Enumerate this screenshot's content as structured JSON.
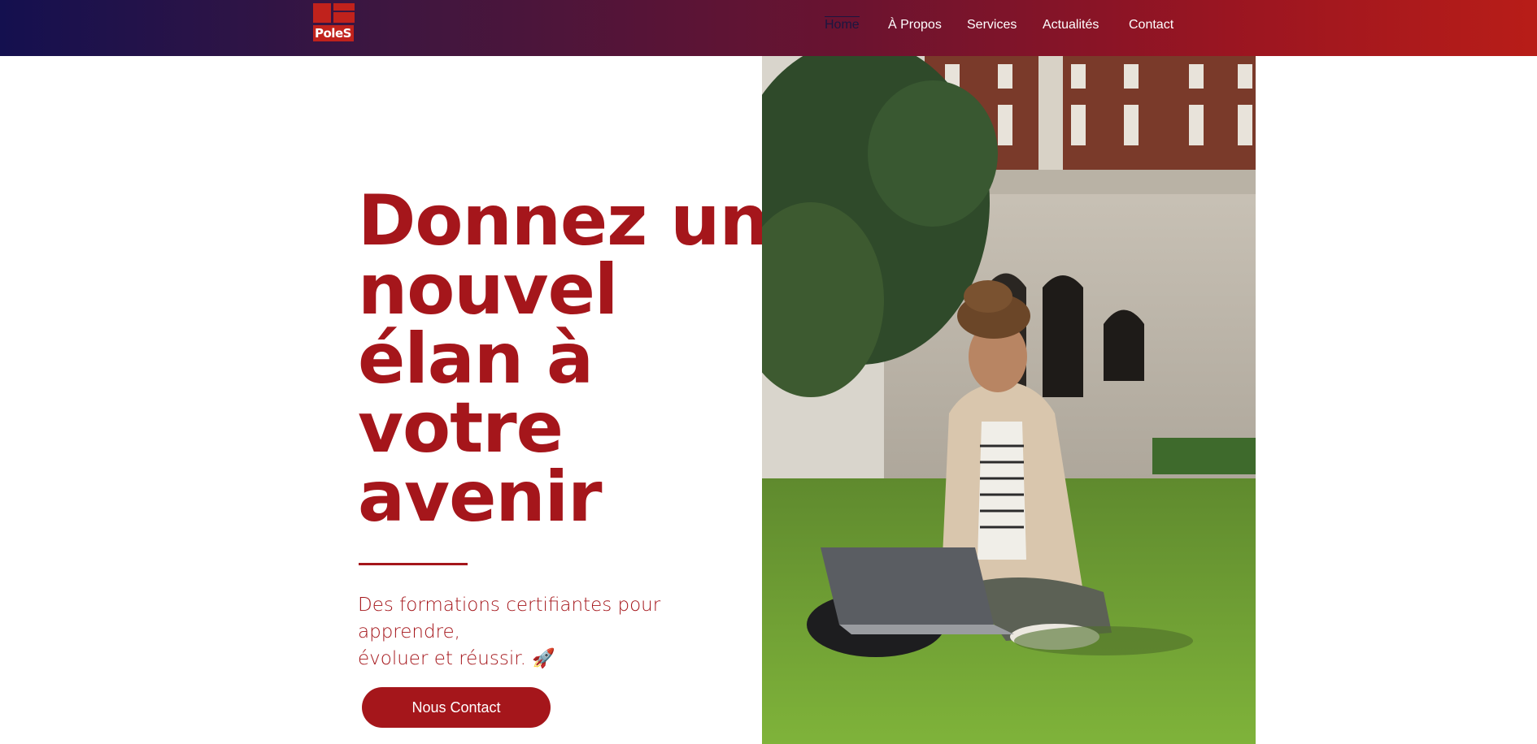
{
  "header": {
    "logo_text": "PoleS",
    "nav": [
      {
        "label": "Home",
        "active": true
      },
      {
        "label": "À Propos",
        "active": false
      },
      {
        "label": "Services",
        "active": false
      },
      {
        "label": "Actualités",
        "active": false
      },
      {
        "label": "Contact",
        "active": false
      }
    ]
  },
  "hero": {
    "title_lines": [
      "Donnez un",
      "nouvel",
      "élan à",
      "votre",
      "avenir"
    ],
    "subtitle_line1": "Des formations certifiantes pour apprendre,",
    "subtitle_line2": "évoluer et réussir.",
    "subtitle_emoji": "🚀",
    "cta_label": "Nous Contact"
  },
  "colors": {
    "brand_red": "#a5161b",
    "header_start": "#14104f",
    "header_end": "#b81d18"
  },
  "image": {
    "subject": "student-with-laptop-on-campus-lawn"
  }
}
